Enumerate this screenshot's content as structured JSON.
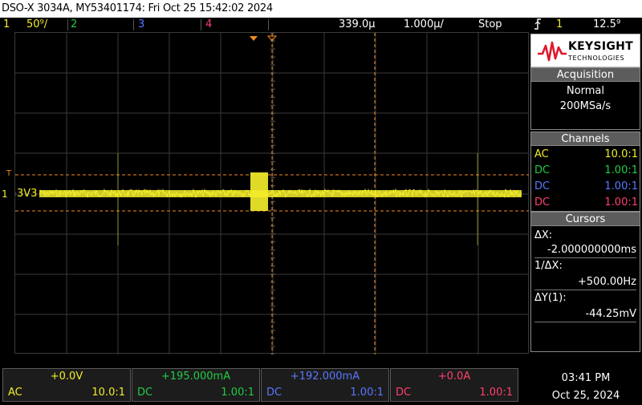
{
  "title_bar": "DSO-X 3034A, MY53401174: Fri Oct 25 15:42:02 2024",
  "status_bar": {
    "ch1_num": "1",
    "ch1_scale": "50⁹/",
    "ch2_num": "2",
    "ch3_num": "3",
    "ch4_num": "4",
    "time_delay": "339.0µ",
    "time_scale": "1.000µ/",
    "run_state": "Stop",
    "trigger_icon": "trigger-edge-icon",
    "trig_source": "1",
    "trig_level": "12.5⁹"
  },
  "waveform": {
    "ground_label": "1",
    "trace_label": "3V3",
    "cursor_t_label": "T"
  },
  "brand": {
    "name": "KEYSIGHT",
    "sub": "TECHNOLOGIES",
    "logo_icon": "keysight-wave-logo"
  },
  "acquisition": {
    "header": "Acquisition",
    "mode": "Normal",
    "rate": "200MSa/s"
  },
  "channels": {
    "header": "Channels",
    "rows": [
      {
        "coupling": "AC",
        "probe": "10.0:1",
        "color": "#f2ec2a"
      },
      {
        "coupling": "DC",
        "probe": "1.00:1",
        "color": "#22cc44"
      },
      {
        "coupling": "DC",
        "probe": "1.00:1",
        "color": "#5a78ff"
      },
      {
        "coupling": "DC",
        "probe": "1.00:1",
        "color": "#ff3f6e"
      }
    ]
  },
  "cursors": {
    "header": "Cursors",
    "dx_label": "ΔX:",
    "dx_value": "-2.000000000ms",
    "inv_dx_label": "1/ΔX:",
    "inv_dx_value": "+500.00Hz",
    "dy_label": "ΔY(1):",
    "dy_value": "-44.25mV"
  },
  "bottom_channels": [
    {
      "offset": "+0.0V",
      "coupling": "AC",
      "probe": "10.0:1",
      "color": "#f2ec2a"
    },
    {
      "offset": "+195.000mA",
      "coupling": "DC",
      "probe": "1.00:1",
      "color": "#22cc44"
    },
    {
      "offset": "+192.000mA",
      "coupling": "DC",
      "probe": "1.00:1",
      "color": "#5a78ff"
    },
    {
      "offset": "+0.0A",
      "coupling": "DC",
      "probe": "1.00:1",
      "color": "#ff3f6e"
    }
  ],
  "clock": {
    "time": "03:41 PM",
    "date": "Oct 25, 2024"
  },
  "colors": {
    "ch1": "#f2ec2a",
    "ch2": "#22cc44",
    "ch3": "#5a78ff",
    "ch4": "#ff3f6e",
    "cursor": "#f08a1c",
    "grid": "#3a3a3a"
  }
}
